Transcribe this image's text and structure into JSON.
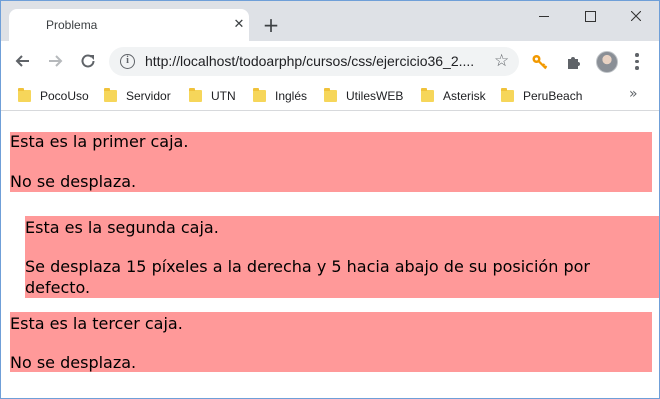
{
  "tab": {
    "title": "Problema",
    "close_glyph": "✕",
    "new_tab_glyph": "+"
  },
  "window_controls": {
    "minimize": "minimize-icon",
    "maximize": "maximize-icon",
    "close": "close-icon"
  },
  "toolbar": {
    "url": "http://localhost/todoarphp/cursos/css/ejercicio36_2....",
    "star_glyph": "☆",
    "info_glyph": "i"
  },
  "bookmarks": {
    "items": [
      {
        "label": "PocoUso"
      },
      {
        "label": "Servidor"
      },
      {
        "label": "UTN"
      },
      {
        "label": "Inglés"
      },
      {
        "label": "UtilesWEB"
      },
      {
        "label": "Asterisk"
      },
      {
        "label": "PeruBeach"
      }
    ],
    "more_glyph": "»"
  },
  "page": {
    "box1": {
      "line1": "Esta es la primer caja.",
      "line2": "No se desplaza."
    },
    "box2": {
      "line1": "Esta es la segunda caja.",
      "line2": "Se desplaza 15 píxeles a la derecha y 5 hacia abajo de su posición por defecto."
    },
    "box3": {
      "line1": "Esta es la tercer caja.",
      "line2": "No se desplaza."
    }
  },
  "colors": {
    "box_background": "#ff9999",
    "tabstrip": "#dee1e6",
    "omnibox": "#f1f3f4"
  }
}
